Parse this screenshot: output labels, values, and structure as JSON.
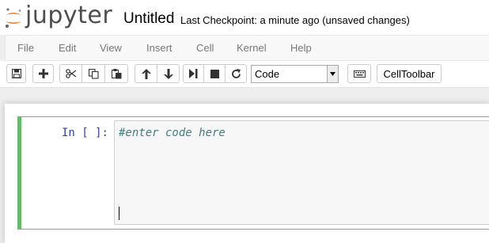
{
  "header": {
    "logo_text": "jupyter",
    "notebook_title": "Untitled",
    "checkpoint_text": "Last Checkpoint: a minute ago (unsaved changes)"
  },
  "menubar": {
    "items": [
      "File",
      "Edit",
      "View",
      "Insert",
      "Cell",
      "Kernel",
      "Help"
    ]
  },
  "toolbar": {
    "buttons": [
      "save-icon",
      "plus-icon",
      "cut-icon",
      "copy-icon",
      "paste-icon",
      "arrow-up-icon",
      "arrow-down-icon",
      "step-forward-icon",
      "stop-icon",
      "refresh-icon",
      "keyboard-icon"
    ],
    "cell_type": "Code",
    "celltoolbar_label": "CellToolbar"
  },
  "cell": {
    "prompt": "In [ ]:",
    "code": "#enter code here"
  },
  "colors": {
    "cell_selected_border": "#66bb6a",
    "prompt": "#303f9f",
    "comment": "#408080",
    "logo_orange": "#f37726"
  }
}
